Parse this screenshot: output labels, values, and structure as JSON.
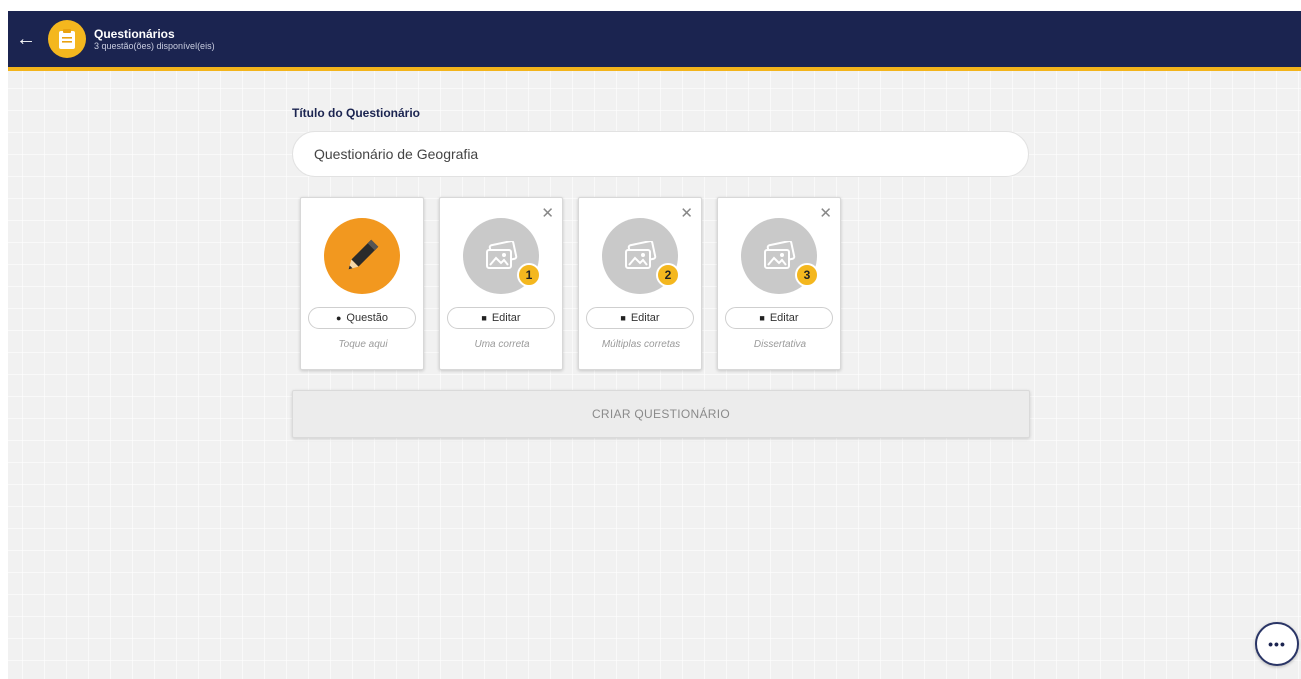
{
  "header": {
    "back_icon": "arrow-left-icon",
    "app_icon": "clipboard-icon",
    "title": "Questionários",
    "subtitle": "3 questão(ões) disponível(eis)"
  },
  "form": {
    "title_label": "Título do Questionário",
    "title_value": "Questionário de Geografia"
  },
  "cards": [
    {
      "type": "add",
      "button_label": "Questão",
      "caption": "Toque aqui",
      "icon": "pencil-icon"
    },
    {
      "type": "question",
      "number": "1",
      "button_label": "Editar",
      "caption": "Uma correta",
      "icon": "image-icon"
    },
    {
      "type": "question",
      "number": "2",
      "button_label": "Editar",
      "caption": "Múltiplas corretas",
      "icon": "image-icon"
    },
    {
      "type": "question",
      "number": "3",
      "button_label": "Editar",
      "caption": "Dissertativa",
      "icon": "image-icon"
    }
  ],
  "actions": {
    "create_label": "CRIAR QUESTIONÁRIO",
    "more_label": "•••"
  },
  "colors": {
    "header_bg": "#1b2450",
    "accent": "#f4b71e",
    "add_circle": "#f2981f",
    "placeholder_circle": "#c9c9c9"
  }
}
